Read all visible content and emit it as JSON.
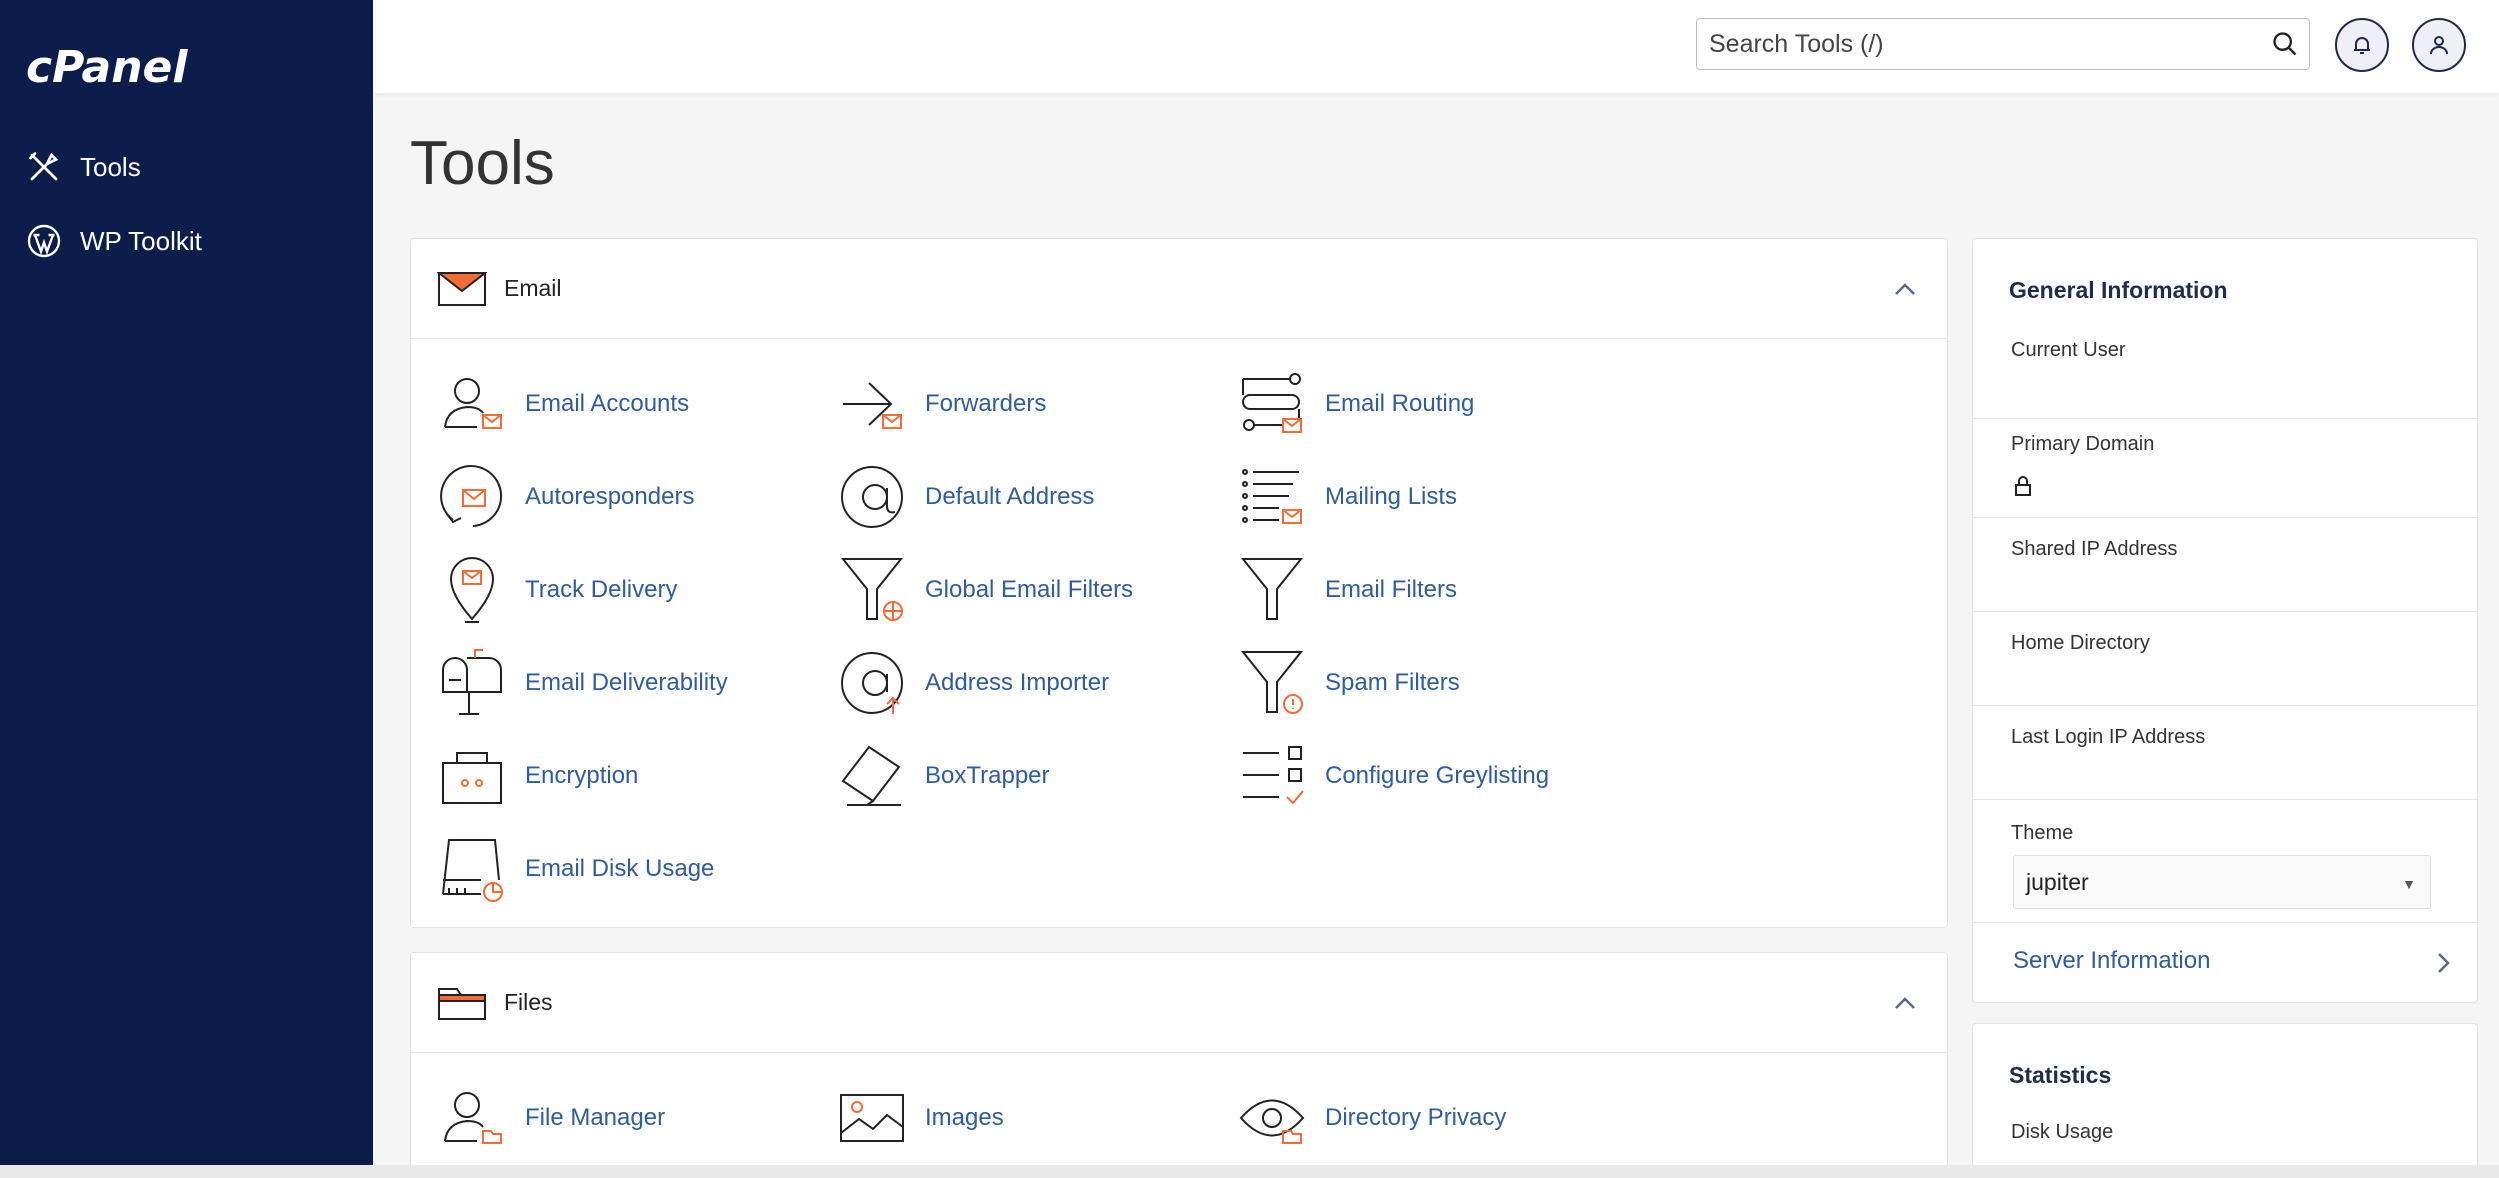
{
  "app": {
    "logo_text": "cPanel"
  },
  "sidebar": {
    "items": [
      {
        "label": "Tools",
        "icon": "tools-icon"
      },
      {
        "label": "WP Toolkit",
        "icon": "wordpress-icon"
      }
    ]
  },
  "topbar": {
    "search_placeholder": "Search Tools (/)"
  },
  "page": {
    "title": "Tools"
  },
  "email_section": {
    "title": "Email",
    "tools": [
      "Email Accounts",
      "Forwarders",
      "Email Routing",
      "Autoresponders",
      "Default Address",
      "Mailing Lists",
      "Track Delivery",
      "Global Email Filters",
      "Email Filters",
      "Email Deliverability",
      "Address Importer",
      "Spam Filters",
      "Encryption",
      "BoxTrapper",
      "Configure Greylisting",
      "Email Disk Usage"
    ]
  },
  "files_section": {
    "title": "Files",
    "tools": [
      "File Manager",
      "Images",
      "Directory Privacy"
    ]
  },
  "general_info": {
    "title": "General Information",
    "current_user_label": "Current User",
    "primary_domain_label": "Primary Domain",
    "shared_ip_label": "Shared IP Address",
    "home_dir_label": "Home Directory",
    "last_login_label": "Last Login IP Address",
    "theme_label": "Theme",
    "theme_value": "jupiter",
    "server_info_link": "Server Information"
  },
  "statistics": {
    "title": "Statistics",
    "disk_usage_label": "Disk Usage"
  },
  "colors": {
    "sidebar": "#0c1d4c",
    "link": "#2e5c9c",
    "accent": "#f26c37"
  }
}
